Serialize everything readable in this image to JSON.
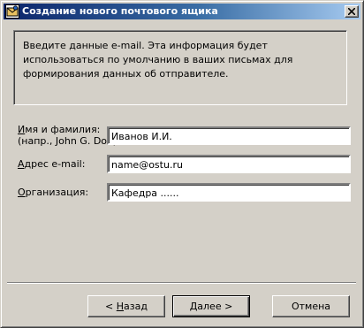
{
  "window": {
    "title": "Создание нового почтового ящика",
    "description": "Введите данные e-mail. Эта информация будет использоваться по умолчанию в ваших письмах для формирования данных об отправителе."
  },
  "form": {
    "name_label_first": "И",
    "name_label_rest": "мя и фамилия:",
    "name_hint": "(напр., John G. Doe)",
    "name_value": "Иванов И.И.",
    "email_label_first": "А",
    "email_label_rest": "дрес e-mail:",
    "email_value": "name@ostu.ru",
    "org_label_first": "О",
    "org_label_rest": "рганизация:",
    "org_value": "Кафедра ......"
  },
  "buttons": {
    "back_prefix": "< ",
    "back_first": "Н",
    "back_rest": "азад",
    "next_first": "Д",
    "next_rest": "алее",
    "next_suffix": " >",
    "cancel": "Отмена"
  }
}
